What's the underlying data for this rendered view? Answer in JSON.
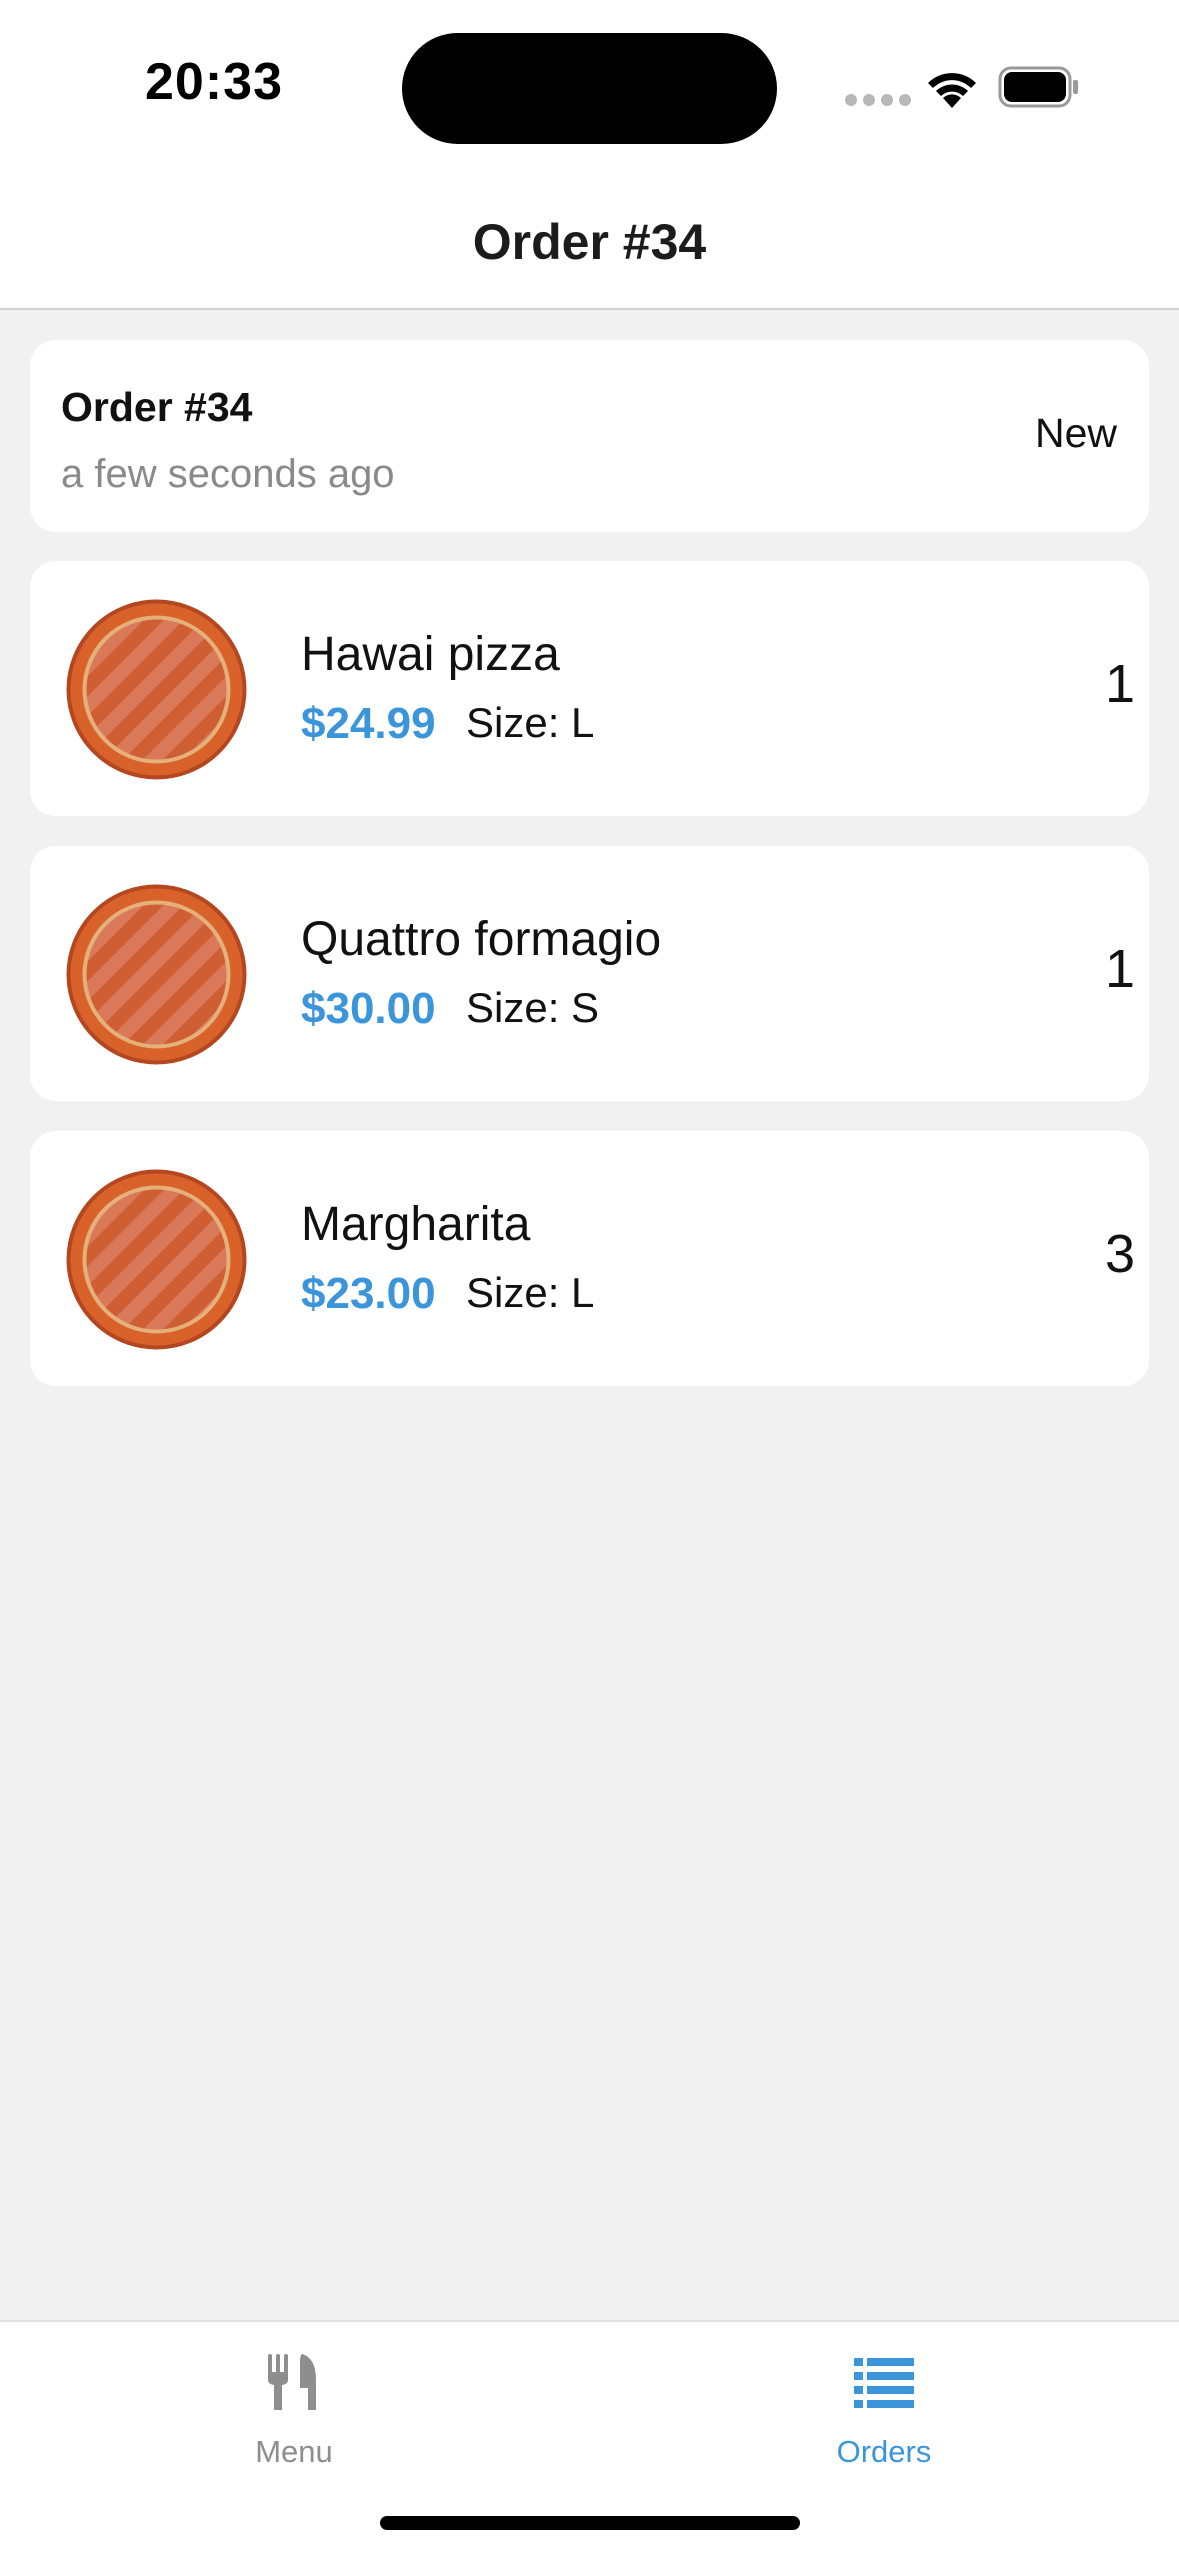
{
  "status_bar": {
    "time": "20:33"
  },
  "header": {
    "title": "Order #34"
  },
  "order": {
    "number": "Order #34",
    "time_ago": "a few seconds ago",
    "status": "New"
  },
  "items": [
    {
      "name": "Hawai pizza",
      "price": "$24.99",
      "size": "Size: L",
      "quantity": "1"
    },
    {
      "name": "Quattro formagio",
      "price": "$30.00",
      "size": "Size: S",
      "quantity": "1"
    },
    {
      "name": "Margharita",
      "price": "$23.00",
      "size": "Size: L",
      "quantity": "3"
    }
  ],
  "tab_bar": {
    "tabs": [
      {
        "label": "Menu",
        "icon": "fork-knife-icon",
        "active": false
      },
      {
        "label": "Orders",
        "icon": "list-icon",
        "active": true
      }
    ]
  },
  "colors": {
    "accent": "#3b95db",
    "background": "#f1f1f1",
    "card": "#ffffff",
    "pizza_crust": "#d9622b",
    "inactive_tab": "#8e8e8e"
  }
}
